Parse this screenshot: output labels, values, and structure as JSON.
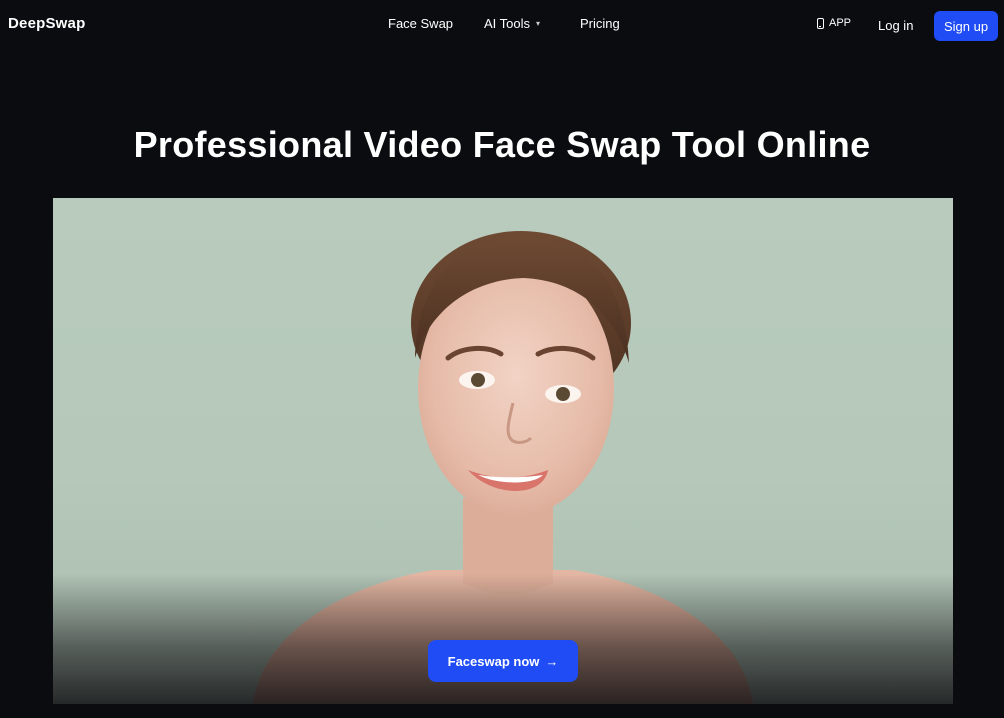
{
  "header": {
    "logo": "DeepSwap",
    "nav": {
      "face_swap": "Face Swap",
      "ai_tools": "AI Tools",
      "pricing": "Pricing"
    },
    "app_label": "APP",
    "login_label": "Log in",
    "signup_label": "Sign up"
  },
  "hero": {
    "title": "Professional Video Face Swap Tool Online",
    "cta_label": "Faceswap now",
    "cta_icon": "→"
  },
  "colors": {
    "background": "#0b0c10",
    "accent": "#1f4cf5",
    "photo_backdrop": "#b8cbbd"
  },
  "icons": {
    "phone": "phone-icon",
    "chevron": "chevron-down-icon",
    "arrow": "arrow-right-icon"
  }
}
